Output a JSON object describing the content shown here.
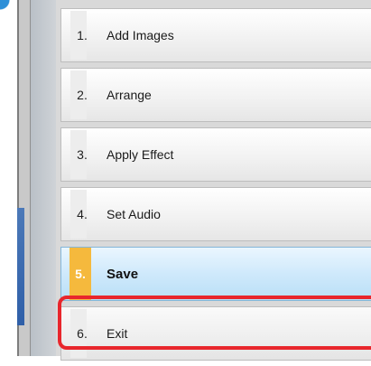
{
  "steps": [
    {
      "number": "1.",
      "label": "Add Images"
    },
    {
      "number": "2.",
      "label": "Arrange"
    },
    {
      "number": "3.",
      "label": "Apply Effect"
    },
    {
      "number": "4.",
      "label": "Set Audio"
    },
    {
      "number": "5.",
      "label": "Save"
    },
    {
      "number": "6.",
      "label": "Exit"
    }
  ],
  "active_step": "5.",
  "highlighted_step": "6.",
  "colors": {
    "active_number_bg": "#f5b93d",
    "active_row_bg": "#cfe9fb",
    "highlight_border": "#e8262c"
  }
}
